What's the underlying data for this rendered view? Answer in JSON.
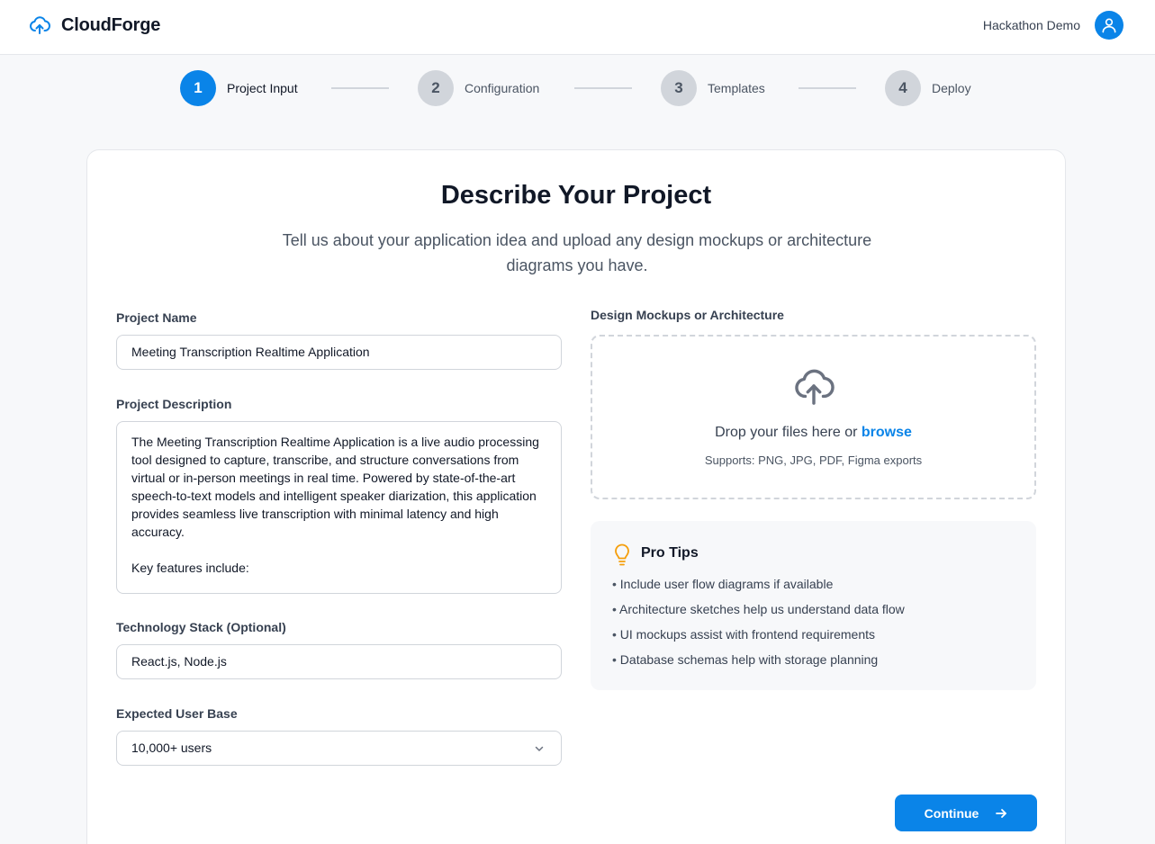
{
  "header": {
    "brand": "CloudForge",
    "user_name": "Hackathon Demo"
  },
  "stepper": {
    "steps": [
      {
        "number": "1",
        "label": "Project Input",
        "active": true
      },
      {
        "number": "2",
        "label": "Configuration",
        "active": false
      },
      {
        "number": "3",
        "label": "Templates",
        "active": false
      },
      {
        "number": "4",
        "label": "Deploy",
        "active": false
      }
    ]
  },
  "card": {
    "title": "Describe Your Project",
    "subtitle": "Tell us about your application idea and upload any design mockups or architecture diagrams you have."
  },
  "form": {
    "project_name_label": "Project Name",
    "project_name_value": "Meeting Transcription Realtime Application",
    "project_description_label": "Project Description",
    "project_description_value": "The Meeting Transcription Realtime Application is a live audio processing tool designed to capture, transcribe, and structure conversations from virtual or in-person meetings in real time. Powered by state-of-the-art speech-to-text models and intelligent speaker diarization, this application provides seamless live transcription with minimal latency and high accuracy.\n\nKey features include:",
    "tech_stack_label": "Technology Stack (Optional)",
    "tech_stack_value": "React.js,  Node.js",
    "user_base_label": "Expected User Base",
    "user_base_value": "10,000+ users"
  },
  "upload": {
    "label": "Design Mockups or Architecture",
    "drop_text": "Drop your files here or ",
    "browse": "browse",
    "supports": "Supports: PNG, JPG, PDF, Figma exports"
  },
  "tips": {
    "title": "Pro Tips",
    "items": [
      "Include user flow diagrams if available",
      "Architecture sketches help us understand data flow",
      "UI mockups assist with frontend requirements",
      "Database schemas help with storage planning"
    ]
  },
  "actions": {
    "continue": "Continue"
  },
  "colors": {
    "accent": "#0a84e8",
    "tip_icon": "#f59e0b"
  },
  "icons": {
    "brand": "cloud-upload-icon",
    "avatar": "user-icon",
    "dropzone": "cloud-upload-icon",
    "tips": "lightbulb-icon",
    "select": "chevron-down-icon",
    "continue": "arrow-right-icon"
  }
}
